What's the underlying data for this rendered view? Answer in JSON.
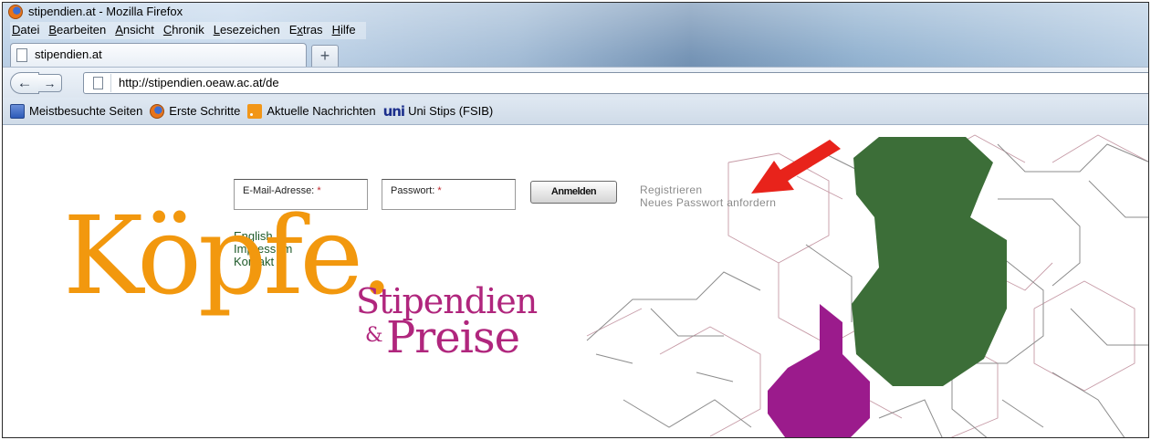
{
  "window": {
    "title": "stipendien.at - Mozilla Firefox"
  },
  "menubar": {
    "items": [
      {
        "label": "Datei",
        "access_key": "D"
      },
      {
        "label": "Bearbeiten",
        "access_key": "B"
      },
      {
        "label": "Ansicht",
        "access_key": "A"
      },
      {
        "label": "Chronik",
        "access_key": "C"
      },
      {
        "label": "Lesezeichen",
        "access_key": "L"
      },
      {
        "label": "Extras",
        "access_key": "x"
      },
      {
        "label": "Hilfe",
        "access_key": "H"
      }
    ]
  },
  "tabs": {
    "active_label": "stipendien.at",
    "new_tab_symbol": "+"
  },
  "navbar": {
    "back_symbol": "←",
    "forward_symbol": "→",
    "url": "http://stipendien.oeaw.ac.at/de"
  },
  "bookmarks": [
    {
      "label": "Meistbesuchte Seiten",
      "icon": "most-visited-icon"
    },
    {
      "label": "Erste Schritte",
      "icon": "firefox-icon"
    },
    {
      "label": "Aktuelle Nachrichten",
      "icon": "rss-icon"
    },
    {
      "label": "Uni Stips (FSIB)",
      "icon": "uni-icon",
      "icon_text": "uni"
    }
  ],
  "page": {
    "email_label": "E-Mail-Adresse:",
    "password_label": "Passwort:",
    "required_mark": "*",
    "login_button": "Anmelden",
    "register_link": "Registrieren",
    "new_password_link": "Neues Passwort anfordern",
    "nav_links": [
      "English",
      "Impressum",
      "Kontakt"
    ],
    "logo": {
      "main": "Köpfe.",
      "line1": "Stipendien",
      "amp": "&",
      "line2": "Preise"
    }
  },
  "colors": {
    "logo_orange": "#f2980e",
    "logo_magenta": "#b0267d",
    "shape_green": "#3c6e38",
    "shape_purple": "#9b1b8c",
    "link_green": "#1f5a2a",
    "annotation_red": "#e8231b"
  }
}
